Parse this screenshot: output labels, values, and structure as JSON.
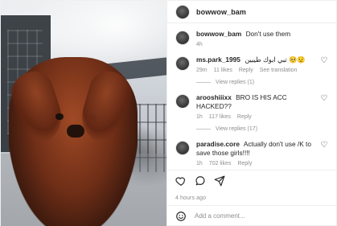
{
  "post": {
    "header": {
      "username": "bowwow_bam"
    },
    "comments": [
      {
        "username": "bowwow_bam",
        "text": "Don't use them",
        "time": "4h"
      },
      {
        "username": "ms.park_1995",
        "text": "تبي ابوك طيبين 🥺😟",
        "time": "29m",
        "likes": "11 likes",
        "reply": "Reply",
        "translate": "See translation",
        "view_replies": "View replies (1)"
      },
      {
        "username": "arooshiiixx",
        "text": "BRO IS HIS ACC HACKED??",
        "time": "1h",
        "likes": "117 likes",
        "reply": "Reply",
        "view_replies": "View replies (17)"
      },
      {
        "username": "paradise.core",
        "text": "Actually don't use /K to save those girls!!!!",
        "time": "1h",
        "likes": "702 likes",
        "reply": "Reply"
      }
    ],
    "actions": {
      "like_icon": "heart-icon",
      "comment_icon": "comment-icon",
      "share_icon": "share-icon"
    },
    "timestamp": "4 hours ago",
    "add_comment": {
      "placeholder": "Add a comment..."
    },
    "colors": {
      "meta_gray": "#8e8e8e",
      "border": "#efefef",
      "text": "#262626"
    }
  }
}
